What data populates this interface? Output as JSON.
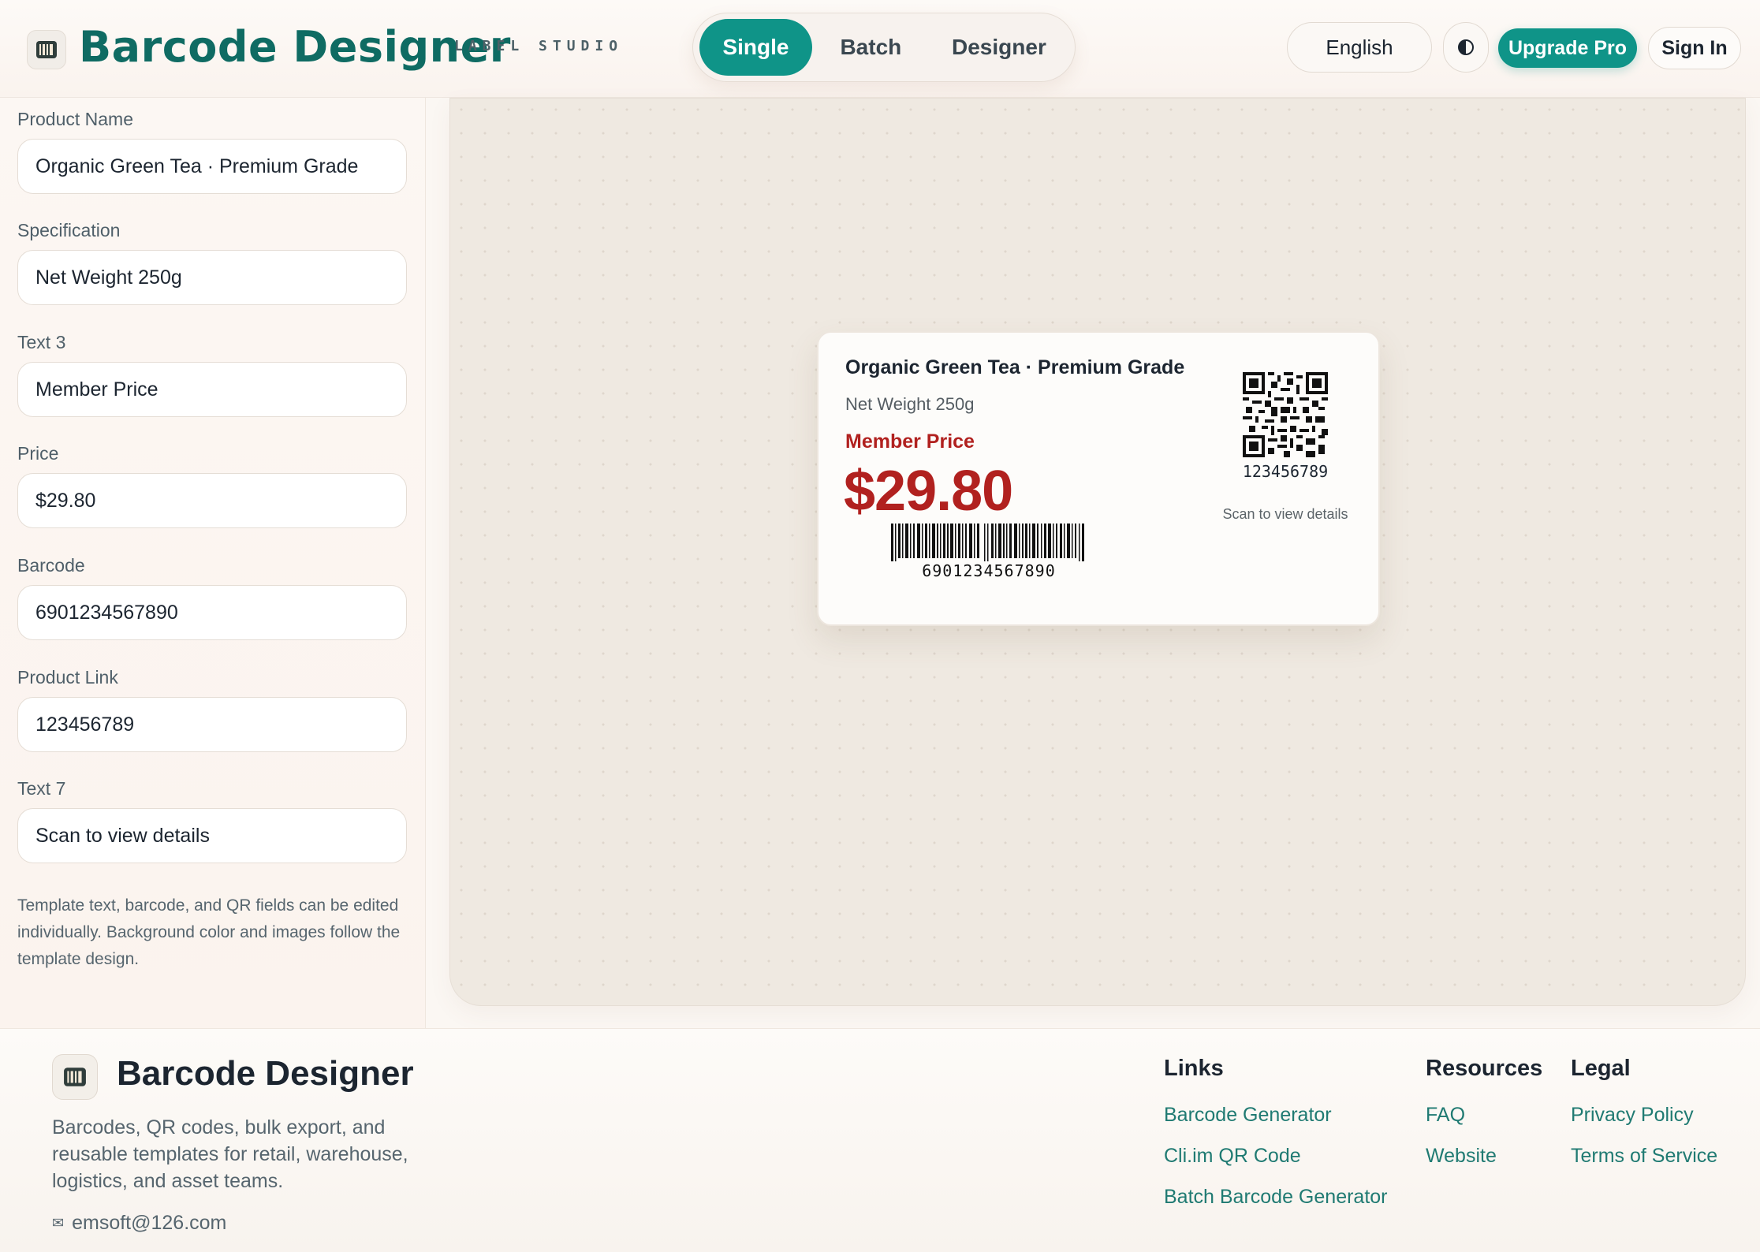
{
  "header": {
    "brand_title": "Barcode Designer",
    "brand_subtitle": "LABEL STUDIO",
    "tabs": [
      {
        "label": "Single",
        "active": true
      },
      {
        "label": "Batch",
        "active": false
      },
      {
        "label": "Designer",
        "active": false
      }
    ],
    "language": "English",
    "upgrade_label": "Upgrade Pro",
    "signin_label": "Sign In"
  },
  "form": {
    "fields": [
      {
        "label": "Product Name",
        "value": "Organic Green Tea · Premium Grade"
      },
      {
        "label": "Specification",
        "value": "Net Weight 250g"
      },
      {
        "label": "Text 3",
        "value": "Member Price"
      },
      {
        "label": "Price",
        "value": "$29.80"
      },
      {
        "label": "Barcode",
        "value": "6901234567890"
      },
      {
        "label": "Product Link",
        "value": "123456789"
      },
      {
        "label": "Text 7",
        "value": "Scan to view details"
      }
    ],
    "help_text": "Template text, barcode, and QR fields can be edited individually. Background color and images follow the template design."
  },
  "label": {
    "product_name": "Organic Green Tea · Premium Grade",
    "specification": "Net Weight 250g",
    "text3": "Member Price",
    "price": "$29.80",
    "barcode": "6901234567890",
    "qr_text": "123456789",
    "scan_text": "Scan to view details"
  },
  "footer": {
    "title": "Barcode Designer",
    "description": "Barcodes, QR codes, bulk export, and reusable templates for retail, warehouse, logistics, and asset teams.",
    "email": "emsoft@126.com",
    "columns": [
      {
        "heading": "Links",
        "items": [
          "Barcode Generator",
          "Cli.im QR Code",
          "Batch Barcode Generator"
        ]
      },
      {
        "heading": "Resources",
        "items": [
          "FAQ",
          "Website"
        ]
      },
      {
        "heading": "Legal",
        "items": [
          "Privacy Policy",
          "Terms of Service"
        ]
      }
    ]
  },
  "colors": {
    "accent": "#0f9488",
    "brand_text": "#0f6b63",
    "price_red": "#b1211f"
  },
  "icons": {
    "logo": "barcode-logo-icon",
    "theme_toggle": "contrast-icon",
    "email": "envelope-icon"
  }
}
